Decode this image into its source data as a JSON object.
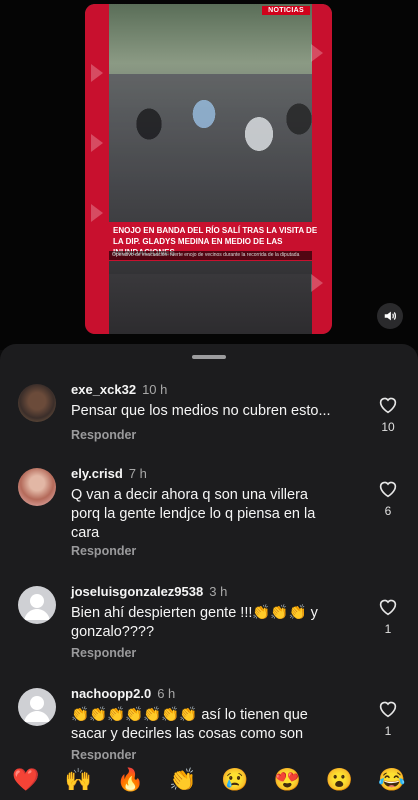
{
  "video": {
    "badge": "NOTICIAS",
    "headline": "ENOJO EN BANDA DEL RÍO SALÍ TRAS LA VISITA DE LA DIP. GLADYS MEDINA EN MEDIO DE LAS INUNDACIONES",
    "subline": "Operativo de evacuación: fuerte enojo de vecinos durante la recorrida de la diputada",
    "audio_icon": "speaker-icon"
  },
  "comments": [
    {
      "username": "exe_xck32",
      "time": "10 h",
      "text": "Pensar que los medios no cubren esto...",
      "reply": "Responder",
      "likes": "10"
    },
    {
      "username": "ely.crisd",
      "time": "7 h",
      "text": "Q van a decir ahora q son una villera porq  la gente lendjce lo q piensa en la cara",
      "reply": "Responder",
      "likes": "6"
    },
    {
      "username": "joseluisgonzalez9538",
      "time": "3 h",
      "text": "Bien ahí despierten gente !!!👏👏👏 y gonzalo????",
      "reply": "Responder",
      "likes": "1"
    },
    {
      "username": "nachoopp2.0",
      "time": "6 h",
      "text": "👏👏👏👏👏👏👏 así lo tienen que sacar y decirles las cosas como son",
      "reply": "Responder",
      "likes": "1"
    }
  ],
  "emoji_bar": [
    "❤️",
    "🙌",
    "🔥",
    "👏",
    "😢",
    "😍",
    "😮",
    "😂"
  ],
  "colors": {
    "brand_red": "#c8102e",
    "sheet_bg": "#1c1c1e"
  }
}
